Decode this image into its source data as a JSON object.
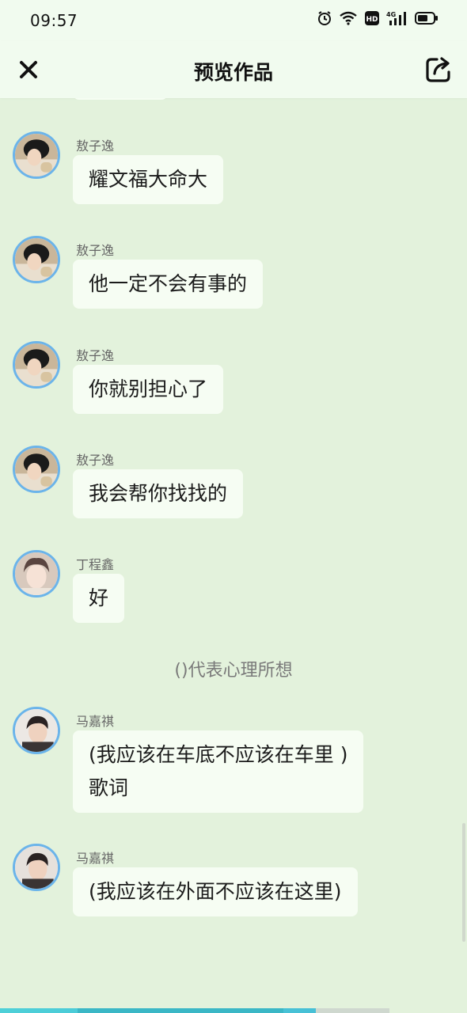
{
  "status_bar": {
    "time": "09:57",
    "hd_label": "HD",
    "net_label": "4G"
  },
  "header": {
    "title": "预览作品",
    "close_icon": "close-icon",
    "share_icon": "share-icon"
  },
  "messages": [
    {
      "sender": "敖子逸",
      "text": "耀文福大命大",
      "avatar": "avatar-aoziyi"
    },
    {
      "sender": "敖子逸",
      "text": "他一定不会有事的",
      "avatar": "avatar-aoziyi"
    },
    {
      "sender": "敖子逸",
      "text": "你就别担心了",
      "avatar": "avatar-aoziyi"
    },
    {
      "sender": "敖子逸",
      "text": "我会帮你找找的",
      "avatar": "avatar-aoziyi"
    },
    {
      "sender": "丁程鑫",
      "text": "好",
      "avatar": "avatar-dingchengxin"
    },
    {
      "sender": "马嘉祺",
      "text": "(我应该在车底不应该在车里 )\n歌词",
      "avatar": "avatar-majiaqi"
    },
    {
      "sender": "马嘉祺",
      "text": "(我应该在外面不应该在这里)",
      "avatar": "avatar-majiaqi"
    }
  ],
  "narration": "()代表心理所想",
  "playback": {
    "progress": 0.81
  },
  "colors": {
    "background": "#e3f2dc",
    "bubble": "#f6fdf3",
    "avatar_ring": "#6bb4ea",
    "progress": "#4ed0d8"
  }
}
